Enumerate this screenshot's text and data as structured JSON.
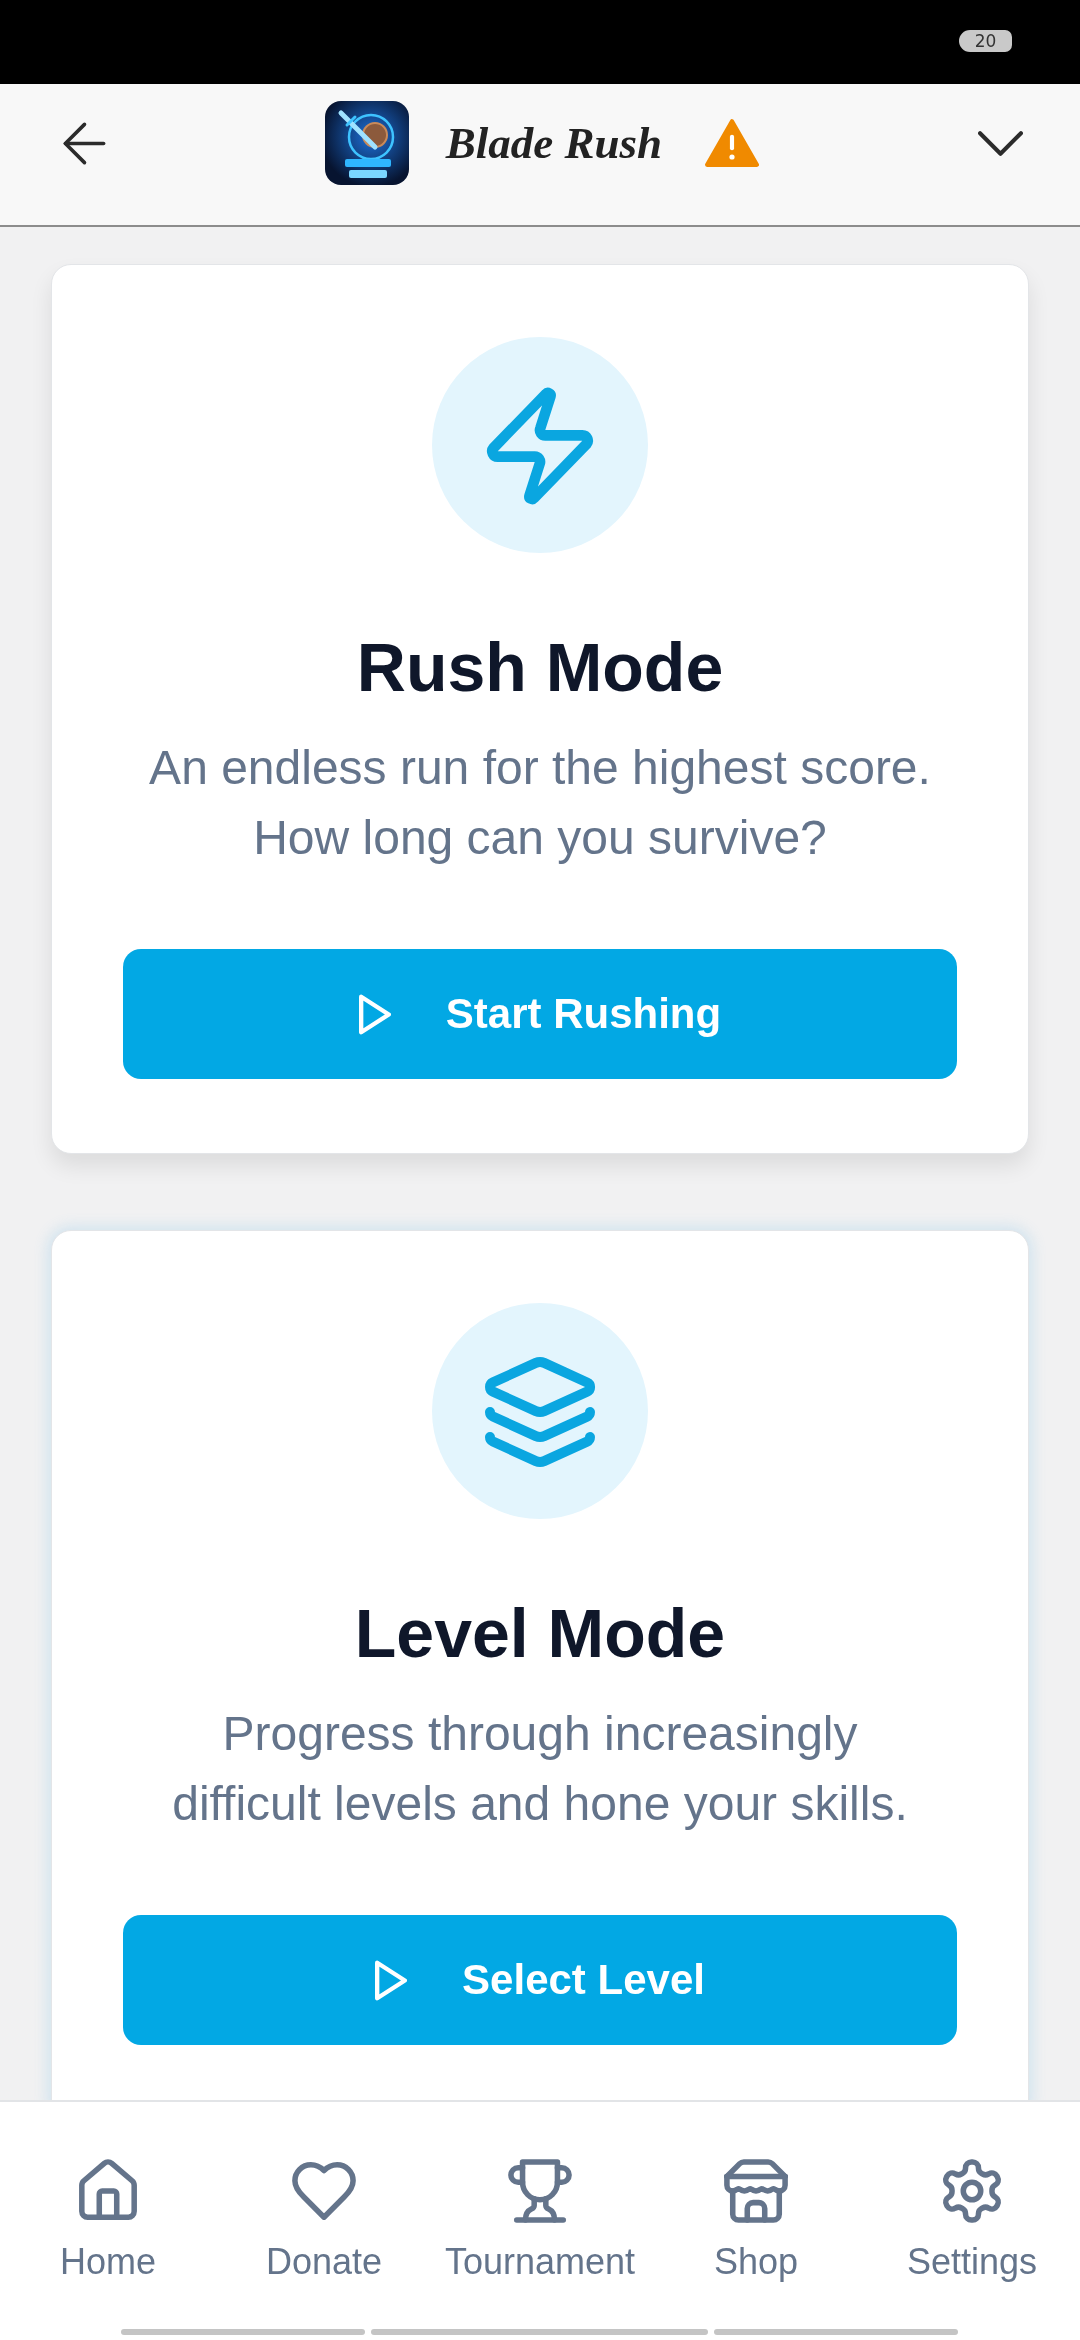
{
  "status_bar": {
    "battery": "20"
  },
  "header": {
    "title": "Blade Rush",
    "warning": true
  },
  "modes": [
    {
      "title": "Rush Mode",
      "description": "An endless run for the highest score. How long can you survive?",
      "button": "Start Rushing",
      "highlighted": false
    },
    {
      "title": "Level Mode",
      "description": "Progress through increasingly difficult levels and hone your skills.",
      "button": "Select Level",
      "highlighted": true
    }
  ],
  "bottom_nav": {
    "items": [
      {
        "label": "Home",
        "selected": false
      },
      {
        "label": "Donate",
        "selected": false
      },
      {
        "label": "Tournament",
        "selected": false
      },
      {
        "label": "Shop",
        "selected": false
      },
      {
        "label": "Settings",
        "selected": false
      }
    ]
  }
}
